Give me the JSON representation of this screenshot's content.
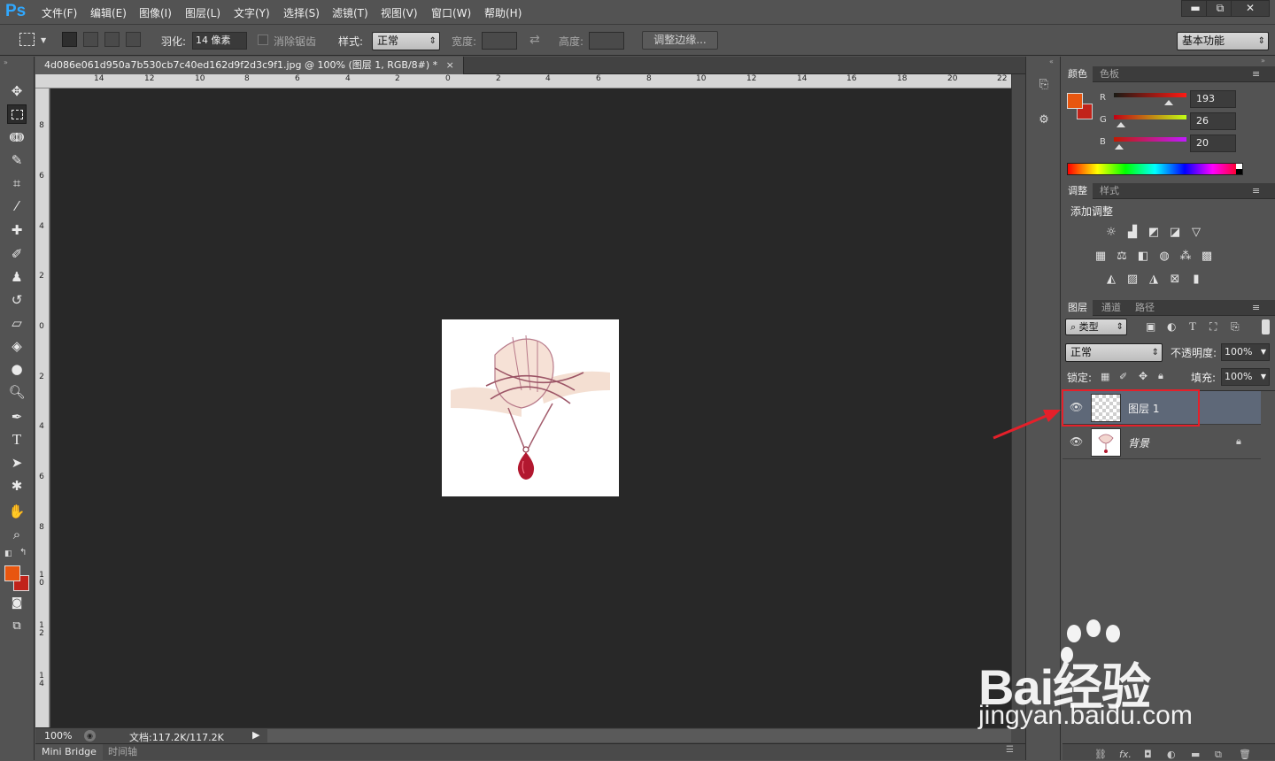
{
  "app": {
    "logo": "Ps"
  },
  "menu": [
    "文件(F)",
    "编辑(E)",
    "图像(I)",
    "图层(L)",
    "文字(Y)",
    "选择(S)",
    "滤镜(T)",
    "视图(V)",
    "窗口(W)",
    "帮助(H)"
  ],
  "window_controls": {
    "minimize": "▬",
    "restore": "⧉",
    "close": "✕"
  },
  "options": {
    "feather_label": "羽化:",
    "feather_value": "14 像素",
    "antialias_label": "消除锯齿",
    "style_label": "样式:",
    "style_value": "正常",
    "width_label": "宽度:",
    "height_label": "高度:",
    "refine_button": "调整边缘...",
    "workspace": "基本功能"
  },
  "document": {
    "tab_title": "4d086e061d950a7b530cb7c40ed162d9f2d3c9f1.jpg @ 100% (图层 1, RGB/8#) *",
    "tab_close": "×",
    "zoom": "100%",
    "doc_info": "文档:117.2K/117.2K"
  },
  "rulers": {
    "top": [
      "14",
      "12",
      "10",
      "8",
      "6",
      "4",
      "2",
      "0",
      "2",
      "4",
      "6",
      "8",
      "10",
      "12",
      "14",
      "16",
      "18",
      "20",
      "22"
    ],
    "left": [
      "8",
      "6",
      "4",
      "2",
      "0",
      "2",
      "4",
      "6",
      "8",
      "10",
      "12",
      "14"
    ]
  },
  "bottom_tabs": [
    "Mini Bridge",
    "时间轴"
  ],
  "color_panel": {
    "tabs": [
      "颜色",
      "色板"
    ],
    "channels": [
      {
        "name": "R",
        "value": "193",
        "fraction": 0.757
      },
      {
        "name": "G",
        "value": "26",
        "fraction": 0.102
      },
      {
        "name": "B",
        "value": "20",
        "fraction": 0.078
      }
    ],
    "foreground": "#e8560f",
    "background": "#c1231a"
  },
  "adjust_panel": {
    "tabs": [
      "调整",
      "样式"
    ],
    "title": "添加调整"
  },
  "layers_panel": {
    "tabs": [
      "图层",
      "通道",
      "路径"
    ],
    "filter_kind": "类型",
    "blend_mode": "正常",
    "opacity_label": "不透明度:",
    "opacity_value": "100%",
    "lock_label": "锁定:",
    "fill_label": "填充:",
    "fill_value": "100%",
    "layers": [
      {
        "name": "图层 1",
        "selected": true
      },
      {
        "name": "背景",
        "selected": false,
        "locked": true
      }
    ]
  },
  "watermark": {
    "brand": "Bai经验",
    "url": "jingyan.baidu.com"
  },
  "icons": [
    "move-icon",
    "marquee-icon",
    "lasso-icon",
    "quick-select-icon",
    "crop-icon",
    "eyedropper-icon",
    "healing-icon",
    "brush-icon",
    "stamp-icon",
    "history-brush-icon",
    "eraser-icon",
    "bucket-icon",
    "blur-icon",
    "dodge-icon",
    "pen-icon",
    "type-icon",
    "path-select-icon",
    "shape-icon",
    "hand-icon",
    "zoom-icon",
    "eye-icon",
    "lock-icon"
  ]
}
